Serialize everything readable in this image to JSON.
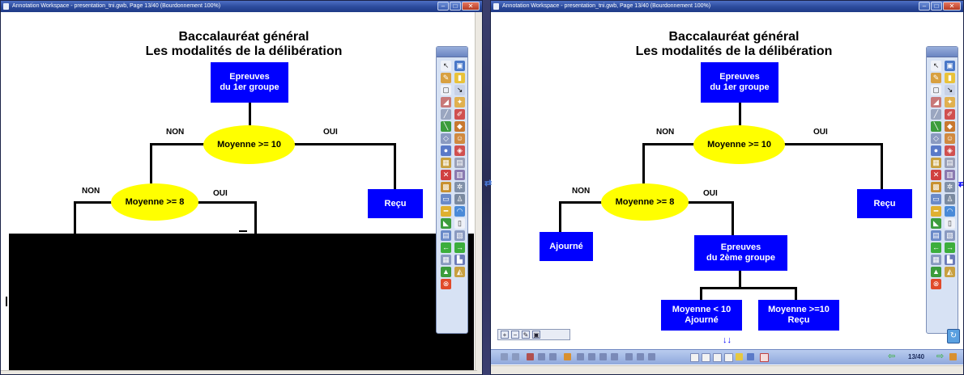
{
  "left_window": {
    "title": "Annotation Workspace - presentation_tni.gwb, Page 13/40  (Bourdonnement 100%)",
    "heading_line1": "Baccalauréat général",
    "heading_line2": "Les modalités de la délibération",
    "box_first_group_l1": "Epreuves",
    "box_first_group_l2": "du 1er groupe",
    "decision_10": "Moyenne >= 10",
    "label_non_top": "NON",
    "label_oui_top": "OUI",
    "box_recu": "Reçu",
    "label_non_8": "NON",
    "label_oui_8": "OUI",
    "decision_8": "Moyenne >= 8"
  },
  "right_window": {
    "title": "Annotation Workspace - presentation_tni.gwb, Page 13/40  (Bourdonnement 100%)",
    "heading_line1": "Baccalauréat général",
    "heading_line2": "Les modalités de la délibération",
    "box_first_group_l1": "Epreuves",
    "box_first_group_l2": "du 1er groupe",
    "decision_10": "Moyenne >= 10",
    "label_non_top": "NON",
    "label_oui_top": "OUI",
    "box_recu": "Reçu",
    "label_non_8": "NON",
    "label_oui_8": "OUI",
    "decision_8": "Moyenne >= 8",
    "box_ajourne": "Ajourné",
    "box_second_group_l1": "Epreuves",
    "box_second_group_l2": "du 2ème groupe",
    "box_lt10_l1": "Moyenne < 10",
    "box_lt10_l2": "Ajourné",
    "box_ge10_l1": "Moyenne >=10",
    "box_ge10_l2": "Reçu",
    "page_counter": "13/40"
  },
  "icons": {
    "palette_tools": [
      "pointer-icon",
      "camera-icon",
      "pen-icon",
      "highlighter-icon",
      "eraser-icon",
      "shape-icon",
      "line-icon",
      "text-icon",
      "fill-icon",
      "color-icon",
      "table-icon",
      "ruler-icon",
      "protractor-icon",
      "compass-icon",
      "undo-icon",
      "redo-icon",
      "page-icon",
      "exit-icon"
    ],
    "nav_prev": "arrow-left-icon",
    "nav_next": "arrow-right-icon"
  },
  "colors": {
    "box_blue": "#0000ff",
    "decision_yellow": "#ffff00",
    "title_bar": "#2b4a9c"
  }
}
